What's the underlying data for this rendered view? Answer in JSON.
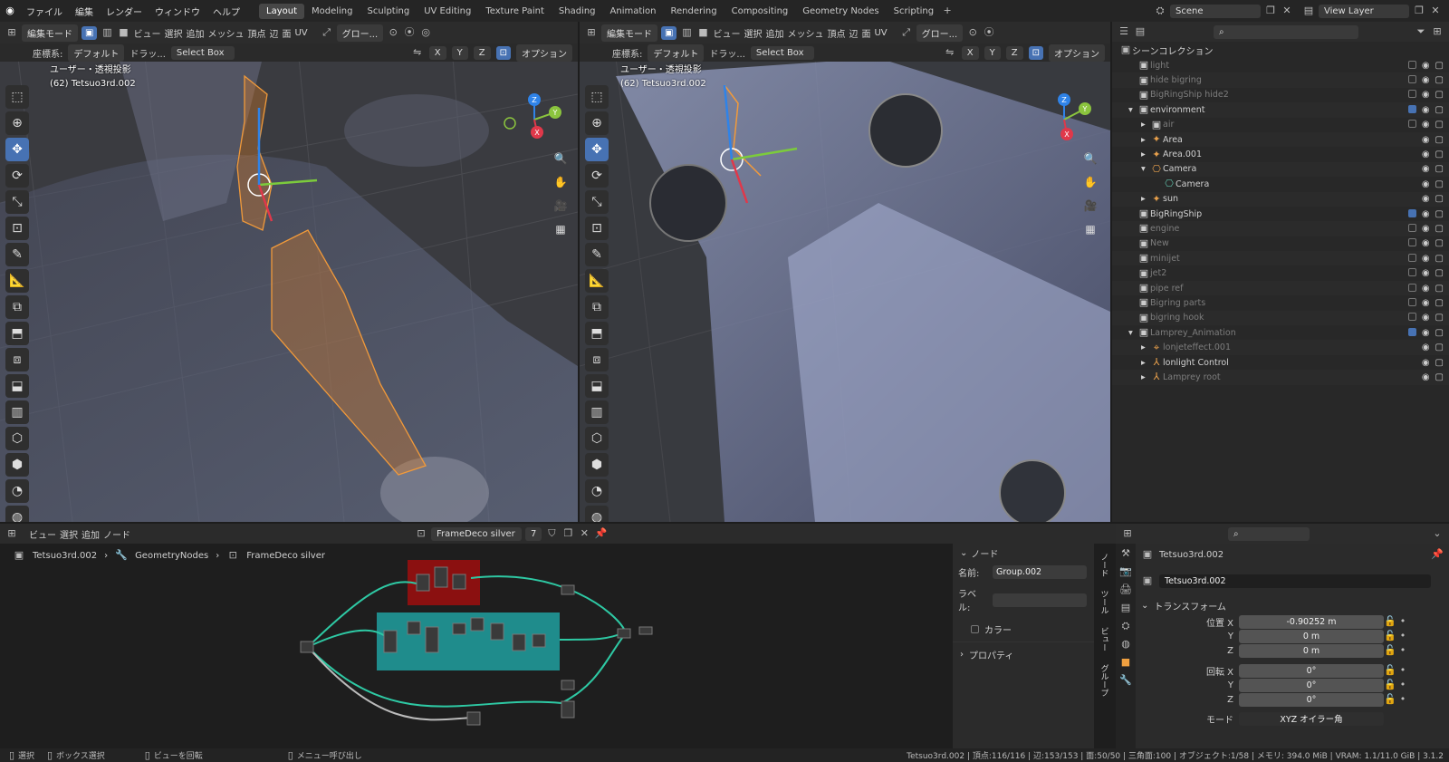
{
  "menu": {
    "app_icon": "blender-logo",
    "items": [
      "ファイル",
      "編集",
      "レンダー",
      "ウィンドウ",
      "ヘルプ"
    ]
  },
  "workspaces": [
    "Layout",
    "Modeling",
    "Sculpting",
    "UV Editing",
    "Texture Paint",
    "Shading",
    "Animation",
    "Rendering",
    "Compositing",
    "Geometry Nodes",
    "Scripting"
  ],
  "active_workspace": "Layout",
  "scene": {
    "label": "Scene",
    "view_layer": "View Layer"
  },
  "viewport_left": {
    "mode": "編集モード",
    "menus": [
      "ビュー",
      "選択",
      "追加",
      "メッシュ",
      "頂点",
      "辺",
      "面",
      "UV"
    ],
    "transform": "グロー...",
    "coord_label": "座標系:",
    "coord_value": "デフォルト",
    "drag_label": "ドラッ...",
    "select_box": "Select Box",
    "axes": [
      "X",
      "Y",
      "Z"
    ],
    "options": "オプション",
    "view_name": "ユーザー・透視投影",
    "object_name": "(62) Tetsuo3rd.002"
  },
  "viewport_right": {
    "mode": "編集モード",
    "menus": [
      "ビュー",
      "選択",
      "追加",
      "メッシュ",
      "頂点",
      "辺",
      "面",
      "UV"
    ],
    "transform": "グロー...",
    "coord_label": "座標系:",
    "coord_value": "デフォルト",
    "drag_label": "ドラッ...",
    "select_box": "Select Box",
    "axes": [
      "X",
      "Y",
      "Z"
    ],
    "options": "オプション",
    "view_name": "ユーザー・透視投影",
    "object_name": "(62) Tetsuo3rd.002"
  },
  "gizmo": {
    "x": "X",
    "y": "Y",
    "z": "Z",
    "color_x": "#e0384a",
    "color_y": "#8bc43e",
    "color_z": "#2f83e8"
  },
  "outliner": {
    "header": "シーンコレクション",
    "rows": [
      {
        "label": "light",
        "depth": 1,
        "dim": true,
        "checked": false
      },
      {
        "label": "hide bigring",
        "depth": 1,
        "dim": true,
        "checked": false
      },
      {
        "label": "BigRingShip hide2",
        "depth": 1,
        "dim": true,
        "checked": false
      },
      {
        "label": "environment",
        "depth": 1,
        "dim": false,
        "checked": true,
        "expanded": true
      },
      {
        "label": "air",
        "depth": 2,
        "dim": true,
        "checked": false
      },
      {
        "label": "Area",
        "depth": 2,
        "dim": false,
        "checked": null,
        "icon": "light"
      },
      {
        "label": "Area.001",
        "depth": 2,
        "dim": false,
        "checked": null,
        "icon": "light"
      },
      {
        "label": "Camera",
        "depth": 2,
        "dim": false,
        "checked": null,
        "icon": "camera",
        "expanded": true
      },
      {
        "label": "Camera",
        "depth": 3,
        "dim": false,
        "checked": null,
        "icon": "camera-data"
      },
      {
        "label": "sun",
        "depth": 2,
        "dim": false,
        "checked": null,
        "icon": "light"
      },
      {
        "label": "BigRingShip",
        "depth": 1,
        "dim": false,
        "checked": true
      },
      {
        "label": "engine",
        "depth": 1,
        "dim": true,
        "checked": false
      },
      {
        "label": "New",
        "depth": 1,
        "dim": true,
        "checked": false
      },
      {
        "label": "minijet",
        "depth": 1,
        "dim": true,
        "checked": false
      },
      {
        "label": "jet2",
        "depth": 1,
        "dim": true,
        "checked": false
      },
      {
        "label": "pipe ref",
        "depth": 1,
        "dim": true,
        "checked": false
      },
      {
        "label": "Bigring parts",
        "depth": 1,
        "dim": true,
        "checked": false
      },
      {
        "label": "bigring hook",
        "depth": 1,
        "dim": true,
        "checked": false
      },
      {
        "label": "Lamprey_Animation",
        "depth": 1,
        "dim": true,
        "checked": true,
        "expanded": true
      },
      {
        "label": "lonjeteffect.001",
        "depth": 2,
        "dim": true,
        "checked": null,
        "icon": "empty"
      },
      {
        "label": "lonlight Control",
        "depth": 2,
        "dim": false,
        "checked": null,
        "icon": "armature"
      },
      {
        "label": "Lamprey root",
        "depth": 2,
        "dim": true,
        "checked": null,
        "icon": "armature"
      }
    ]
  },
  "node_editor": {
    "menus": [
      "ビュー",
      "選択",
      "追加",
      "ノード"
    ],
    "tree_name": "FrameDeco silver",
    "users": "7",
    "breadcrumb": [
      "Tetsuo3rd.002",
      "GeometryNodes",
      "FrameDeco silver"
    ]
  },
  "node_panel": {
    "section": "ノード",
    "name_label": "名前:",
    "name_value": "Group.002",
    "label_label": "ラベル:",
    "label_value": "",
    "color_label": "カラー",
    "properties": "プロパティ",
    "tabs": [
      "ノード",
      "ツール",
      "ビュー",
      "グループ"
    ]
  },
  "properties": {
    "object": "Tetsuo3rd.002",
    "object_field": "Tetsuo3rd.002",
    "transform": "トランスフォーム",
    "location_label": "位置 X",
    "location": [
      "-0.90252 m",
      "0 m",
      "0 m"
    ],
    "rotation_label": "回転 X",
    "rotation": [
      "0°",
      "0°",
      "0°"
    ],
    "axis_y": "Y",
    "axis_z": "Z",
    "mode_label": "モード",
    "mode_value": "XYZ オイラー角"
  },
  "status": {
    "select": "選択",
    "box_select": "ボックス選択",
    "rotate_view": "ビューを回転",
    "call_menu": "メニュー呼び出し",
    "stats": "Tetsuo3rd.002 | 頂点:116/116 | 辺:153/153 | 面:50/50 | 三角面:100 | オブジェクト:1/58 | メモリ: 394.0 MiB | VRAM: 1.1/11.0 GiB | 3.1.2"
  }
}
